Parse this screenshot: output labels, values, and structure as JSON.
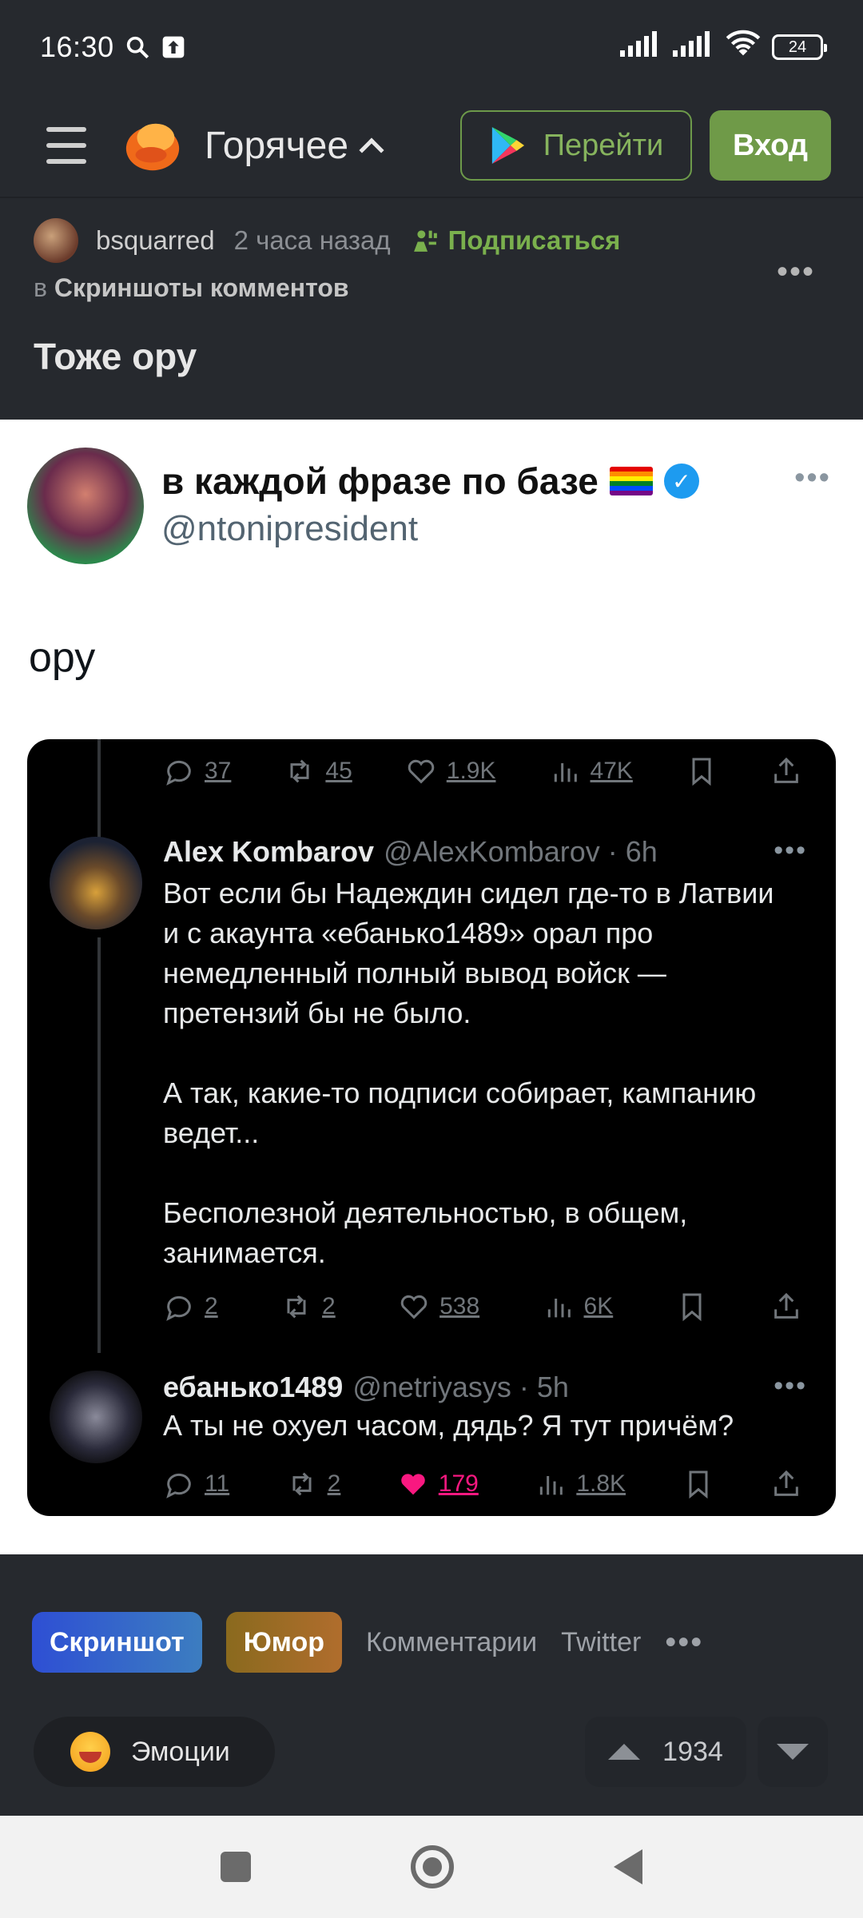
{
  "status_bar": {
    "time": "16:30",
    "battery": "24"
  },
  "header": {
    "feed_title": "Горячее",
    "go_button": "Перейти",
    "login_button": "Вход"
  },
  "post": {
    "author": "bsquarred",
    "time_ago": "2 часа назад",
    "subscribe": "Подписаться",
    "community_prefix": "в",
    "community": "Скриншоты комментов",
    "title": "Тоже ору"
  },
  "tweet": {
    "name": "в каждой фразе по базе",
    "handle": "@ntonipresident",
    "text": "ору",
    "top_actions": {
      "replies": "37",
      "retweets": "45",
      "likes": "1.9K",
      "views": "47K"
    },
    "replies": [
      {
        "name": "Alex Kombarov",
        "handle": "@AlexKombarov · 6h",
        "paragraphs": [
          "Вот если бы Надеждин сидел где-то в Латвии и с акаунта «ебанько1489» орал про немедленный полный вывод войск — претензий бы не было.",
          "А так, какие-то подписи собирает, кампанию ведет...",
          "Бесполезной деятельностью, в общем, занимается."
        ],
        "actions": {
          "replies": "2",
          "retweets": "2",
          "likes": "538",
          "views": "6K"
        }
      },
      {
        "name": "ебанько1489",
        "handle": "@netriyasys · 5h",
        "paragraphs": [
          "А ты не охуел часом, дядь? Я тут причём?"
        ],
        "actions": {
          "replies": "11",
          "retweets": "2",
          "likes": "179",
          "views": "1.8K"
        }
      }
    ]
  },
  "tags": [
    "Скриншот",
    "Юмор",
    "Комментарии",
    "Twitter"
  ],
  "bottom": {
    "emotions": "Эмоции",
    "rating": "1934"
  },
  "colors": {
    "accent_green": "#6f9a48",
    "like_pink": "#f91880",
    "twitter_blue": "#1d9bf0"
  }
}
